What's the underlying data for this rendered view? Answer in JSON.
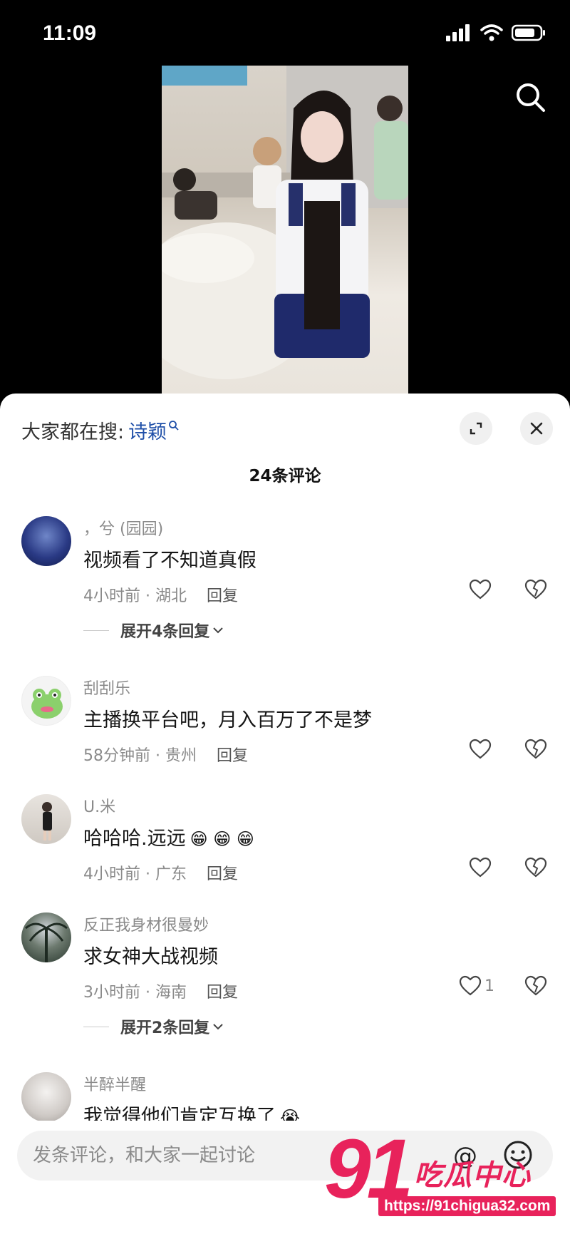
{
  "status_bar": {
    "time": "11:09"
  },
  "comments_sheet": {
    "hot_search_prefix": "大家都在搜:",
    "hot_search_keyword": "诗颖",
    "count_label": "24条评论"
  },
  "comments": [
    {
      "user": "，兮 (园园)",
      "text": "视频看了不知道真假",
      "time": "4小时前 · 湖北",
      "reply": "回复",
      "likes": "",
      "expand": "展开4条回复"
    },
    {
      "user": "刮刮乐",
      "text": "主播换平台吧，月入百万了不是梦",
      "time": "58分钟前 · 贵州",
      "reply": "回复",
      "likes": ""
    },
    {
      "user": "U.米",
      "text": "哈哈哈.远远",
      "emojis": "😁 😁 😁",
      "time": "4小时前 · 广东",
      "reply": "回复",
      "likes": ""
    },
    {
      "user": "反正我身材很曼妙",
      "text": "求女神大战视频",
      "time": "3小时前 · 海南",
      "reply": "回复",
      "likes": "1",
      "expand": "展开2条回复"
    },
    {
      "user": "半醉半醒",
      "text": "我觉得他们肯定互换了",
      "emojis": "😭",
      "time": "",
      "reply": "",
      "likes": ""
    }
  ],
  "input_bar": {
    "placeholder": "发条评论，和大家一起讨论"
  },
  "watermark": {
    "logo_number": "91",
    "logo_text": "吃瓜中心",
    "url": "https://91chigua32.com"
  },
  "icons": {
    "search": "search-icon",
    "expand": "expand-icon",
    "close": "close-icon",
    "like": "heart-icon",
    "dislike": "broken-heart-icon",
    "at": "at-icon",
    "emoji": "smiley-icon"
  },
  "colors": {
    "link_blue": "#1f4fa8",
    "watermark_pink": "#e8225b",
    "meta_gray": "#8a8a8a"
  }
}
